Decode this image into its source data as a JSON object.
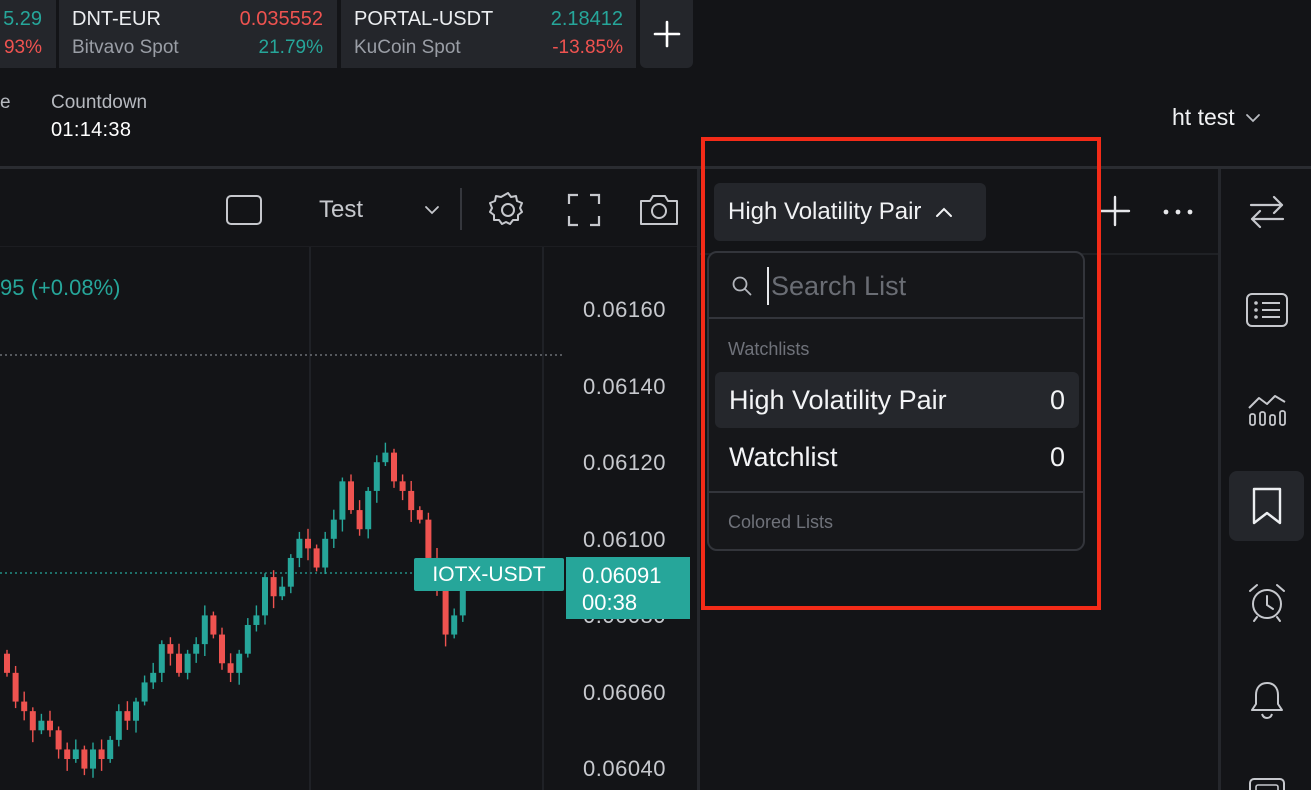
{
  "tickers": [
    {
      "symbol": "",
      "exchange": "",
      "price": "5.29",
      "change": "93%",
      "price_color": "#26a69a",
      "change_color": "#ef5350"
    },
    {
      "symbol": "DNT-EUR",
      "exchange": "Bitvavo Spot",
      "price": "0.035552",
      "change": "21.79%",
      "price_color": "#ef5350",
      "change_color": "#26a69a"
    },
    {
      "symbol": "PORTAL-USDT",
      "exchange": "KuCoin Spot",
      "price": "2.18412",
      "change": "-13.85%",
      "price_color": "#26a69a",
      "change_color": "#ef5350"
    }
  ],
  "header": {
    "cut_label": "e",
    "countdown_label": "Countdown",
    "countdown_value": "01:14:38",
    "account_name": "ht test"
  },
  "toolbar": {
    "layout_name": "Test"
  },
  "chart": {
    "change_text": "95 (+0.08%)",
    "price_axis": [
      "0.06160",
      "0.06140",
      "0.06120",
      "0.06100",
      "0.06080",
      "0.06060",
      "0.06040"
    ],
    "symbol_tag": "IOTX-USDT",
    "current_price": "0.06091",
    "bar_countdown": "00:38",
    "up_color": "#26a69a",
    "down_color": "#ef5350"
  },
  "watchlist_panel": {
    "selected_list": "High Volatility Pair",
    "search_placeholder": "Search List",
    "section_watchlists": "Watchlists",
    "lists": [
      {
        "name": "High Volatility Pair",
        "count": "0",
        "active": true
      },
      {
        "name": "Watchlist",
        "count": "0",
        "active": false
      }
    ],
    "section_colored": "Colored Lists"
  },
  "sidebar_icons": [
    "swap-icon",
    "list-icon",
    "chart-icon",
    "bookmark-icon",
    "alarm-icon",
    "bell-icon",
    "screen-icon"
  ],
  "highlight_color": "#f42b18"
}
